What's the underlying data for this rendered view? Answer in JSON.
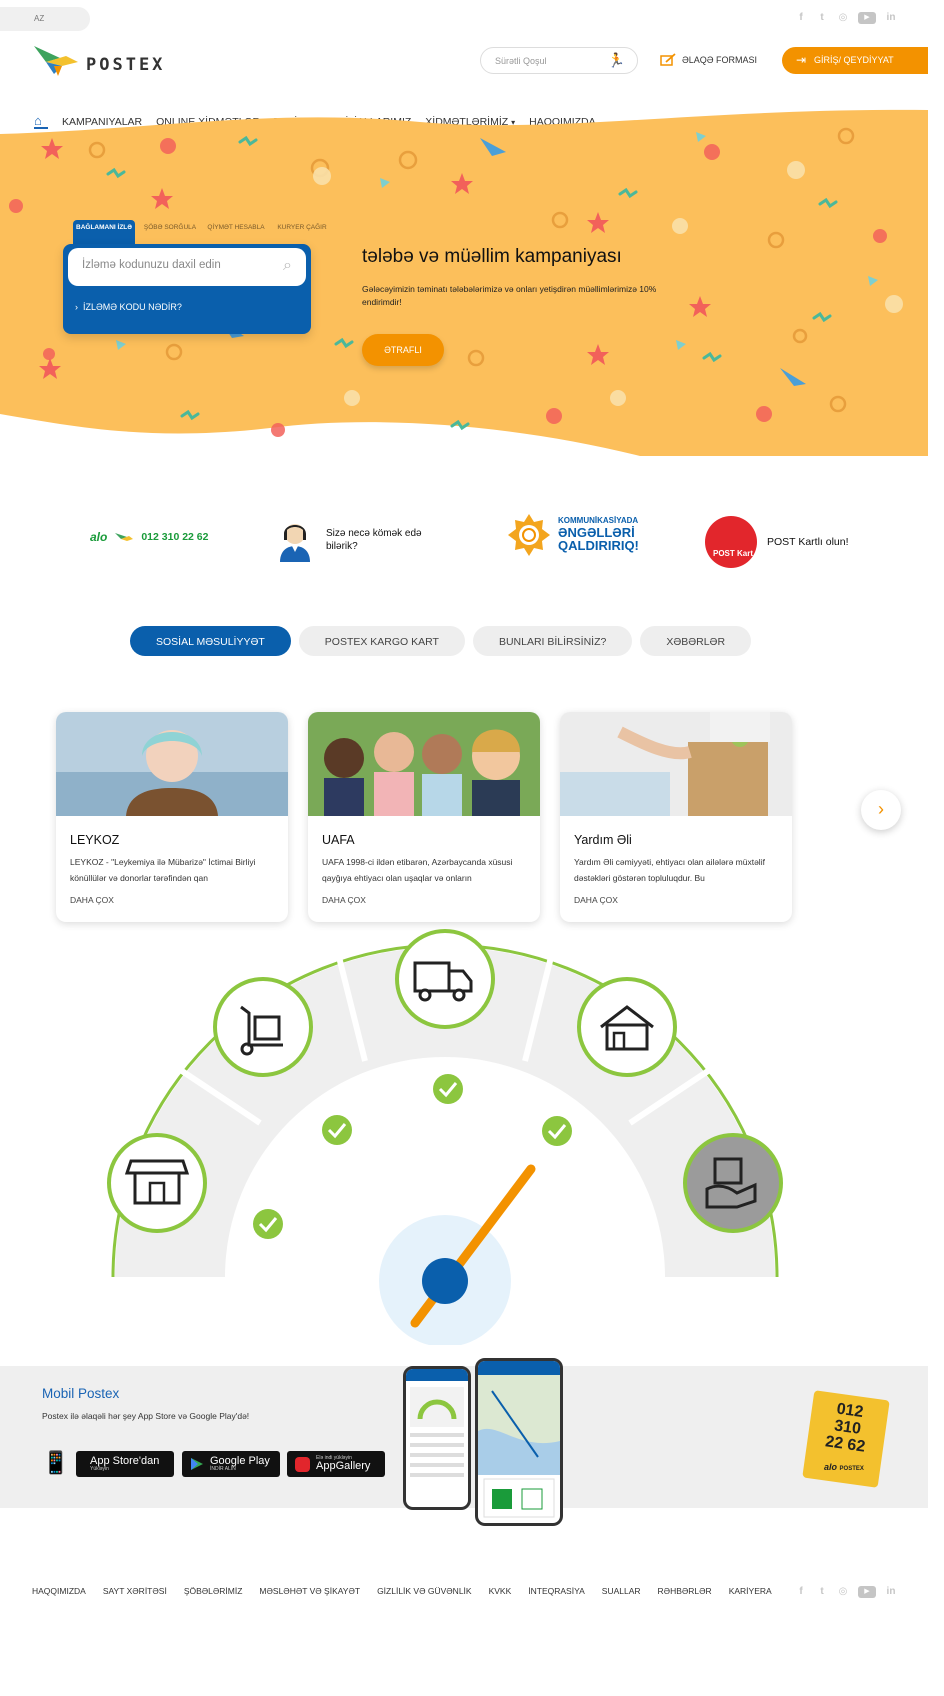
{
  "topbar": {
    "language": "AZ",
    "socials": [
      "facebook-icon",
      "twitter-icon",
      "instagram-icon",
      "youtube-icon",
      "linkedin-icon"
    ]
  },
  "header": {
    "logo": "POSTEX",
    "search_placeholder": "Sürətli Qoşul",
    "contact_form": "ƏLAQƏ FORMASI",
    "login": "GİRİŞ/ QEYDİYYAT"
  },
  "nav": [
    "KAMPANIYALAR",
    "ONLINE XİDMƏTLƏR",
    "TARİFLƏR",
    "FİLİALLARIMIZ",
    "XİDMƏTLƏRİMİZ",
    "HAQQIMIZDA"
  ],
  "hero": {
    "tabs": [
      "BAĞLAMANI İZLƏ",
      "ŞÖBƏ SORĞULA",
      "QİYMƏT HESABLA",
      "KURYER ÇAĞIR"
    ],
    "track_placeholder": "İzləmə kodunuzu daxil edin",
    "track_help": "İZLƏMƏ KODU NƏDİR?",
    "title": "tələbə və müəllim kampaniyası",
    "desc": "Gələcəyimizin təminatı tələbələrimizə və onları yetişdirən müəllimlərimizə 10% endirimdir!",
    "button": "ƏTRAFLI"
  },
  "strip": {
    "alo": "alo",
    "phone": "012 310 22 62",
    "help": "Sizə necə kömək edə bilərik?",
    "komm_line1": "KOMMUNİKASİYADA",
    "komm_line2": "ƏNGƏLLƏRİ",
    "komm_line3": "QALDIRIRIQ!",
    "post_card_label": "POST Kart",
    "post_card": "POST Kartlı olun!"
  },
  "pills": [
    "SOSİAL MƏSULİYYƏT",
    "POSTEX KARGO KART",
    "BUNLARI BİLİRSİNİZ?",
    "XƏBƏRLƏR"
  ],
  "cards": [
    {
      "title": "LEYKOZ",
      "desc": "LEYKOZ - \"Leykemiya ilə Mübarizə\" İctimai Birliyi könüllülər və donorlar tərəfindən qan",
      "more": "DAHA ÇOX"
    },
    {
      "title": "UAFA",
      "desc": "UAFA 1998-ci ildən etibarən, Azərbaycanda xüsusi qayğıya ehtiyacı olan uşaqlar və onların",
      "more": "DAHA ÇOX"
    },
    {
      "title": "Yardım Əli",
      "desc": "Yardım Əli cəmiyyəti, ehtiyacı olan ailələrə müxtəlif dəstəkləri göstərən topluluqdur. Bu",
      "more": "DAHA ÇOX"
    }
  ],
  "gauge": {
    "icons": [
      "shop-icon",
      "hand-truck-icon",
      "delivery-truck-icon",
      "house-icon",
      "package-hand-icon"
    ],
    "checks": 4
  },
  "mobile": {
    "title": "Mobil Postex",
    "desc": "Postex ilə əlaqəli hər şey App Store və Google Play'də!",
    "stores": [
      {
        "name": "App Store'dan",
        "sub": "Yükləyin"
      },
      {
        "name": "Google Play",
        "sub": "İNDİR ALIN"
      },
      {
        "name": "AppGallery",
        "sub": "Elə indi yükləyin"
      }
    ],
    "phone_badge": [
      "012",
      "310",
      "22 62"
    ],
    "badge_alo": "alo",
    "badge_brand": "POSTEX"
  },
  "footer": [
    "HAQQIMIZDA",
    "SAYT XƏRİTƏSİ",
    "ŞÖBƏLƏRİMİZ",
    "MƏSLƏHƏT VƏ ŞİKAYƏT",
    "GİZLİLİK VƏ GÜVƏNLİK",
    "KVKK",
    "İNTEQRASİYA",
    "SUALLAR",
    "RƏHBƏRLƏR",
    "KARİYERA"
  ],
  "colors": {
    "accent": "#f39200",
    "brand_blue": "#0a5fac",
    "hero_bg": "#fcbf5b",
    "gauge_green": "#8cc63f"
  }
}
